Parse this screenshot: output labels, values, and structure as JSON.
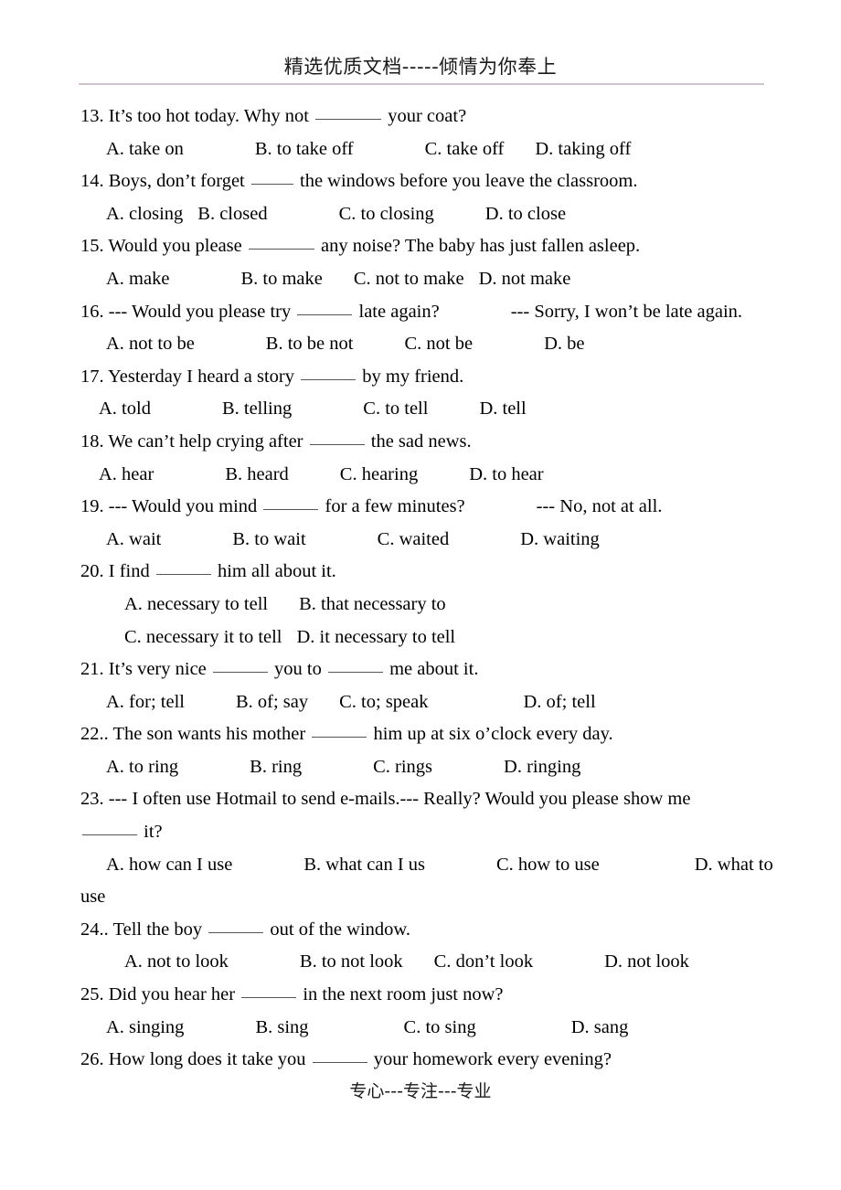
{
  "header": {
    "title": "精选优质文档-----倾情为你奉上"
  },
  "footer": {
    "text": "专心---专注---专业"
  },
  "questions": [
    {
      "number": "13.",
      "stem_before": "It’s too hot today. Why not",
      "stem_after": "your coat?",
      "options": [
        "A. take on",
        "B. to take off",
        "C. take off",
        "D. taking off"
      ]
    },
    {
      "number": "14.",
      "stem_before": "Boys, don’t forget",
      "stem_after": "the windows before you leave the classroom.",
      "options": [
        "A. closing",
        "B. closed",
        "C. to closing",
        "D. to close"
      ]
    },
    {
      "number": "15.",
      "stem_before": "Would you please",
      "stem_after": "any noise? The baby has just fallen asleep.",
      "options": [
        "A. make",
        "B. to make",
        "C. not to make",
        "D. not make"
      ]
    },
    {
      "number": "16.",
      "stem_before": "--- Would you please try",
      "stem_after": "late again?",
      "stem_reply": "--- Sorry, I won’t be late again.",
      "options": [
        "A. not to be",
        "B. to be not",
        "C. not be",
        "D. be"
      ]
    },
    {
      "number": "17.",
      "stem_before": "Yesterday I heard a story",
      "stem_after": "by my friend.",
      "options": [
        "A. told",
        "B. telling",
        "C. to tell",
        "D. tell"
      ]
    },
    {
      "number": "18.",
      "stem_before": "We can’t help crying after",
      "stem_after": "the sad news.",
      "options": [
        "A. hear",
        "B. heard",
        "C. hearing",
        "D. to hear"
      ]
    },
    {
      "number": "19.",
      "stem_before": "--- Would you mind",
      "stem_after": "for a few minutes?",
      "stem_reply": "--- No, not at all.",
      "options": [
        "A. wait",
        "B. to wait",
        "C. waited",
        "D. waiting"
      ]
    },
    {
      "number": "20.",
      "stem_before": "I find",
      "stem_after": "him all about it.",
      "options": [
        "A. necessary to tell",
        "B. that necessary to",
        "C. necessary it to tell",
        "D. it necessary to tell"
      ]
    },
    {
      "number": "21.",
      "stem_before": "It’s very nice",
      "stem_middle": "you to",
      "stem_after": "me about it.",
      "options": [
        "A. for; tell",
        "B. of; say",
        "C. to; speak",
        "D. of; tell"
      ]
    },
    {
      "number": "22..",
      "stem_before": "The son wants his mother",
      "stem_after": "him up at six o’clock every day.",
      "options": [
        "A. to ring",
        "B. ring",
        "C. rings",
        "D. ringing"
      ]
    },
    {
      "number": "23.",
      "stem_before": "--- I often use Hotmail to send e-mails.--- Really? Would you please show me",
      "stem_after": "it?",
      "options": [
        "A. how can I use",
        "B. what can I us",
        "C. how to use",
        "D. what to use"
      ],
      "wrap_tail": "use"
    },
    {
      "number": "24..",
      "stem_before": "Tell the boy",
      "stem_after": "out of the window.",
      "options": [
        "A. not to look",
        "B. to not look",
        "C. don’t look",
        "D. not look"
      ]
    },
    {
      "number": "25.",
      "stem_before": "Did you hear her",
      "stem_after": "in the next room just now?",
      "options": [
        "A. singing",
        "B. sing",
        "C. to sing",
        "D. sang"
      ]
    },
    {
      "number": "26.",
      "stem_before": "How long does it take you",
      "stem_after": "your homework every evening?",
      "options": []
    }
  ]
}
